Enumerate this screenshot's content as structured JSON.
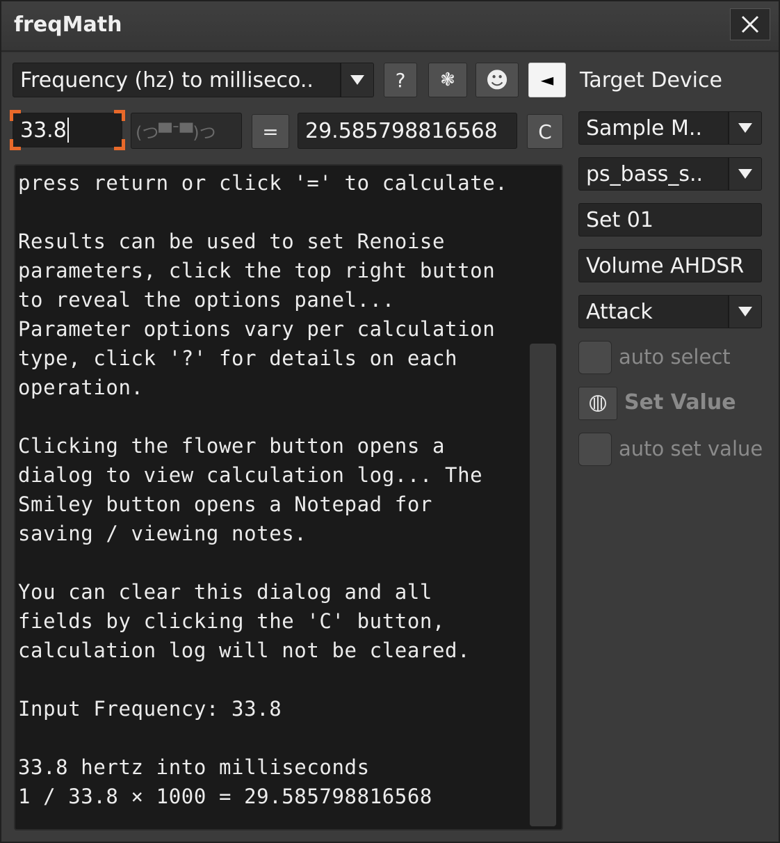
{
  "window": {
    "title": "freqMath"
  },
  "toolbar": {
    "mode_select": "Frequency (hz) to milliseco..",
    "help_label": "?",
    "log_label": "❃",
    "notes_label": "☻",
    "options_label": "◄"
  },
  "calc": {
    "input_value": "33.8",
    "emoticon_placeholder": "(つ▀¯▀)つ",
    "equals_label": "=",
    "result_value": "29.585798816568",
    "clear_label": "C"
  },
  "console": {
    "text": "press return or click '=' to calculate.\n\nResults can be used to set Renoise\nparameters, click the top right button\nto reveal the options panel...\nParameter options vary per calculation\ntype, click '?' for details on each\noperation.\n\nClicking the flower button opens a\ndialog to view calculation log... The\nSmiley button opens a Notepad for\nsaving / viewing notes.\n\nYou can clear this dialog and all\nfields by clicking the 'C' button,\ncalculation log will not be cleared.\n\nInput Frequency: 33.8\n\n33.8 hertz into milliseconds\n1 / 33.8 × 1000 = 29.585798816568"
  },
  "options": {
    "heading": "Target Device",
    "instrument_select": "Sample M..",
    "device_select": "ps_bass_s..",
    "set_field": "Set 01",
    "parameter_field": "Volume AHDSR",
    "param_select": "Attack",
    "auto_select_label": "auto select",
    "set_value_label": "Set Value",
    "auto_set_value_label": "auto set value"
  },
  "colors": {
    "background": "#3b3b3b",
    "field": "#262626",
    "console": "#1a1a1a",
    "focus_accent": "#e8692a",
    "disabled_text": "#8a8a8a"
  }
}
